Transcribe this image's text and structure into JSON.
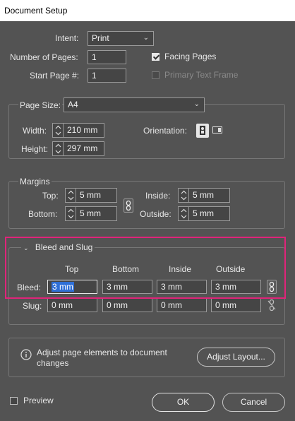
{
  "window": {
    "title": "Document Setup"
  },
  "top": {
    "intent_label": "Intent:",
    "intent_value": "Print",
    "pages_label": "Number of Pages:",
    "pages_value": "1",
    "start_page_label": "Start Page #:",
    "start_page_value": "1",
    "facing_pages_label": "Facing Pages",
    "facing_pages_checked": true,
    "primary_text_frame_label": "Primary Text Frame",
    "primary_text_frame_checked": false
  },
  "page_size": {
    "label": "Page Size:",
    "value": "A4",
    "width_label": "Width:",
    "width_value": "210 mm",
    "height_label": "Height:",
    "height_value": "297 mm",
    "orientation_label": "Orientation:",
    "orientation_options": [
      "portrait-icon",
      "landscape-icon"
    ],
    "orientation_selected": "portrait"
  },
  "margins": {
    "title": "Margins",
    "top_label": "Top:",
    "top_value": "5 mm",
    "bottom_label": "Bottom:",
    "bottom_value": "5 mm",
    "inside_label": "Inside:",
    "inside_value": "5 mm",
    "outside_label": "Outside:",
    "outside_value": "5 mm"
  },
  "bleed_slug": {
    "title": "Bleed and Slug",
    "columns": [
      "Top",
      "Bottom",
      "Inside",
      "Outside"
    ],
    "bleed_label": "Bleed:",
    "bleed_values": [
      "3 mm",
      "3 mm",
      "3 mm",
      "3 mm"
    ],
    "slug_label": "Slug:",
    "slug_values": [
      "0 mm",
      "0 mm",
      "0 mm",
      "0 mm"
    ]
  },
  "info": {
    "text": "Adjust page elements to document changes",
    "adjust_button": "Adjust Layout..."
  },
  "footer": {
    "preview_label": "Preview",
    "preview_checked": false,
    "ok_button": "OK",
    "cancel_button": "Cancel"
  },
  "colors": {
    "background": "#535353",
    "field": "#454545",
    "highlight": "#e0247a",
    "selection": "#2f6fd6"
  }
}
